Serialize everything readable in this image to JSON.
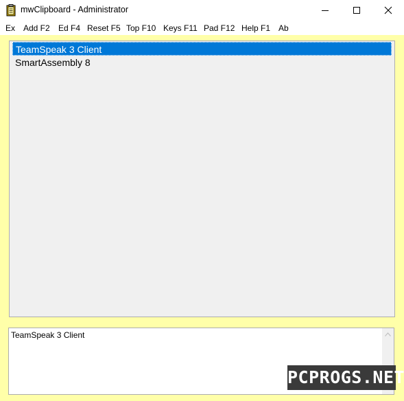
{
  "window": {
    "title": "mwClipboard - Administrator"
  },
  "menu": [
    {
      "label": "Ex"
    },
    {
      "label": "Add F2"
    },
    {
      "label": "Ed F4"
    },
    {
      "label": "Reset F5"
    },
    {
      "label": "Top F10"
    },
    {
      "label": "Keys F11"
    },
    {
      "label": "Pad F12"
    },
    {
      "label": "Help F1"
    },
    {
      "label": "Ab"
    }
  ],
  "clips": [
    {
      "text": "TeamSpeak 3 Client",
      "selected": true
    },
    {
      "text": "SmartAssembly 8",
      "selected": false
    }
  ],
  "detail": {
    "text": "TeamSpeak 3 Client"
  },
  "watermark": {
    "text": "PCPROGS.NET"
  },
  "colors": {
    "window_bg": "#ffffa9",
    "selection": "#0078d7",
    "list_bg": "#f0f0f0"
  }
}
